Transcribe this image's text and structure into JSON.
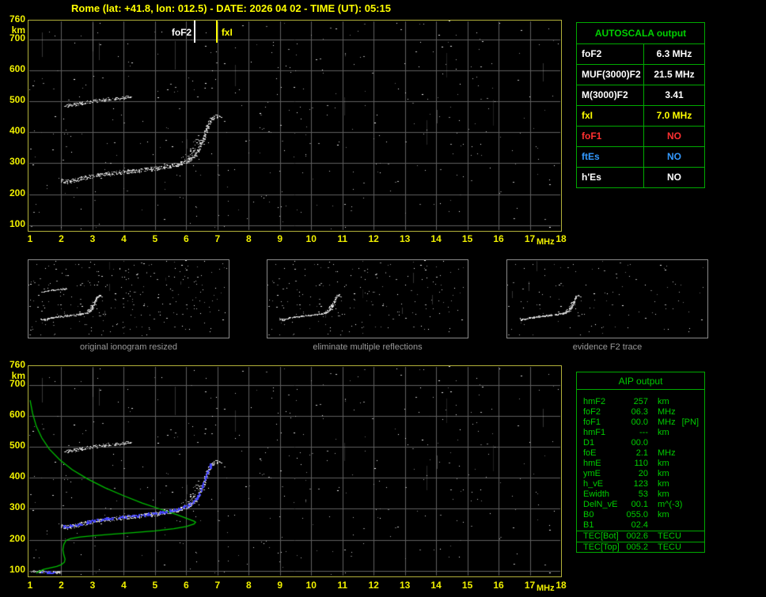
{
  "header": {
    "title": "Rome (lat: +41.8, lon: 012.5) - DATE: 2026 04 02 - TIME (UT): 05:15"
  },
  "colors": {
    "title": "#ffff00",
    "axis_label": "#f0f000",
    "plot_border": "#b2b03a",
    "grid": "#5f5f5f",
    "table_border": "#00aa00",
    "table_header_text": "#00d000",
    "aip_text": "#00cc00",
    "profile_green": "#00c000",
    "restored_blue": "#4646ff",
    "caption": "#9a9a9a"
  },
  "chart_data": {
    "type": "scatter",
    "description": "vertical-incidence ionogram: virtual height (km) vs sounding frequency (MHz); same ionogram in top and bottom panels, bottom panel adds restored F2 trace (blue) and electron density profile (green)",
    "x_unit": "MHz",
    "y_unit": "km",
    "xlim": [
      1,
      18
    ],
    "ylim_km": [
      82,
      760
    ],
    "x_ticks": [
      "1",
      "2",
      "3",
      "4",
      "5",
      "6",
      "7",
      "8",
      "9",
      "10",
      "11",
      "12",
      "13",
      "14",
      "15",
      "16",
      "17",
      "18"
    ],
    "y_axis_top_tick": "760",
    "y_ticks": [
      "700",
      "600",
      "500",
      "400",
      "300",
      "200",
      "100"
    ],
    "grid_km": [
      100,
      200,
      300,
      400,
      500,
      600,
      700
    ],
    "markers": [
      {
        "label": "foF2",
        "x": 6.3,
        "color": "#ffffff",
        "label_side": "left"
      },
      {
        "label": "fxI",
        "x": 7.0,
        "color": "#ffff00",
        "label_side": "right"
      }
    ],
    "traces": {
      "f2": {
        "name": "F-region echo trace",
        "density": 2.2,
        "jitter_x": 3,
        "jitter_y": 5,
        "points": [
          [
            1.95,
            250
          ],
          [
            2.05,
            243
          ],
          [
            2.2,
            241
          ],
          [
            2.5,
            248
          ],
          [
            2.9,
            258
          ],
          [
            3.4,
            266
          ],
          [
            3.9,
            272
          ],
          [
            4.4,
            277
          ],
          [
            4.9,
            283
          ],
          [
            5.3,
            289
          ],
          [
            5.7,
            297
          ],
          [
            6.0,
            307
          ],
          [
            6.2,
            320
          ],
          [
            6.35,
            338
          ],
          [
            6.45,
            358
          ],
          [
            6.55,
            382
          ],
          [
            6.62,
            405
          ],
          [
            6.7,
            428
          ],
          [
            6.8,
            445
          ],
          [
            6.95,
            452
          ],
          [
            7.08,
            455
          ]
        ]
      },
      "second_hop": {
        "name": "second-hop multiple reflection",
        "density": 1.6,
        "jitter_x": 3,
        "jitter_y": 4,
        "points": [
          [
            2.05,
            482
          ],
          [
            2.35,
            489
          ],
          [
            2.7,
            496
          ],
          [
            3.1,
            502
          ],
          [
            3.5,
            507
          ],
          [
            3.85,
            511
          ],
          [
            4.2,
            514
          ]
        ]
      },
      "spread": {
        "name": "spread echoes near F2 cusp",
        "density": 1.2,
        "jitter_x": 7,
        "jitter_y": 11,
        "points": [
          [
            5.85,
            302
          ],
          [
            6.05,
            318
          ],
          [
            6.2,
            340
          ],
          [
            6.3,
            362
          ],
          [
            6.38,
            385
          ]
        ]
      },
      "e_region": {
        "name": "E-region echo",
        "density": 2.0,
        "jitter_x": 2,
        "jitter_y": 3,
        "points": [
          [
            1.05,
            100
          ],
          [
            1.5,
            97
          ],
          [
            2.0,
            96
          ]
        ]
      }
    },
    "noise": {
      "seed": 9001,
      "plot_count": 400,
      "streak_count": 12
    },
    "profile": [
      [
        1.0,
        650
      ],
      [
        1.08,
        608
      ],
      [
        1.2,
        566
      ],
      [
        1.38,
        528
      ],
      [
        1.62,
        492
      ],
      [
        1.95,
        458
      ],
      [
        2.35,
        426
      ],
      [
        2.85,
        396
      ],
      [
        3.4,
        368
      ],
      [
        4.0,
        342
      ],
      [
        4.6,
        318
      ],
      [
        5.2,
        298
      ],
      [
        5.7,
        281
      ],
      [
        6.05,
        268
      ],
      [
        6.25,
        260
      ],
      [
        6.3,
        257
      ],
      [
        6.25,
        251
      ],
      [
        6.0,
        243
      ],
      [
        5.6,
        236
      ],
      [
        5.0,
        229
      ],
      [
        4.3,
        223
      ],
      [
        3.6,
        218
      ],
      [
        3.0,
        213
      ],
      [
        2.6,
        209
      ],
      [
        2.3,
        204
      ],
      [
        2.15,
        198
      ],
      [
        2.08,
        185
      ],
      [
        2.05,
        168
      ],
      [
        2.08,
        152
      ],
      [
        2.12,
        138
      ],
      [
        2.1,
        128
      ],
      [
        2.0,
        120
      ],
      [
        1.85,
        114
      ],
      [
        1.65,
        110
      ],
      [
        1.45,
        105
      ],
      [
        1.3,
        99
      ],
      [
        1.2,
        92
      ]
    ],
    "restored_blue": {
      "f_start": 2.15,
      "f_end": 6.72,
      "e_points": [
        [
          1.35,
          98
        ],
        [
          1.8,
          96
        ]
      ]
    }
  },
  "autoscala_table": {
    "title": "AUTOSCALA output",
    "rows": [
      {
        "label": "foF2",
        "value": "6.3 MHz",
        "color": "#ffffff"
      },
      {
        "label": "MUF(3000)F2",
        "value": "21.5 MHz",
        "color": "#ffffff"
      },
      {
        "label": "M(3000)F2",
        "value": "3.41",
        "color": "#ffffff"
      },
      {
        "label": "fxI",
        "value": "7.0 MHz",
        "color": "#ffff00"
      },
      {
        "label": "foF1",
        "value": "NO",
        "color": "#ff3030"
      },
      {
        "label": "ftEs",
        "value": "NO",
        "color": "#3399ff"
      },
      {
        "label": "h'Es",
        "value": "NO",
        "color": "#ffffff"
      }
    ]
  },
  "thumbnails": [
    {
      "caption": "original ionogram resized",
      "noise": 260,
      "streaks": 6,
      "traces": [
        "f2",
        "second_hop",
        "spread"
      ]
    },
    {
      "caption": "eliminate multiple reflections",
      "noise": 200,
      "streaks": 5,
      "traces": [
        "f2",
        "spread"
      ]
    },
    {
      "caption": "evidence F2 trace",
      "noise": 120,
      "streaks": 3,
      "traces": [
        "f2",
        "spread"
      ]
    }
  ],
  "aip_table": {
    "title": "AIP output",
    "rows": [
      {
        "name": "hmF2",
        "value": "257",
        "unit": "km",
        "note": ""
      },
      {
        "name": "foF2",
        "value": "06.3",
        "unit": "MHz",
        "note": ""
      },
      {
        "name": "foF1",
        "value": "00.0",
        "unit": "MHz",
        "note": "[PN]"
      },
      {
        "name": "hmF1",
        "value": "---",
        "unit": "km",
        "note": ""
      },
      {
        "name": "D1",
        "value": "00.0",
        "unit": "",
        "note": ""
      },
      {
        "name": "foE",
        "value": "2.1",
        "unit": "MHz",
        "note": ""
      },
      {
        "name": "hmE",
        "value": "110",
        "unit": "km",
        "note": ""
      },
      {
        "name": "ymE",
        "value": "20",
        "unit": "km",
        "note": ""
      },
      {
        "name": "h_vE",
        "value": "123",
        "unit": "km",
        "note": ""
      },
      {
        "name": "Ewidth",
        "value": "53",
        "unit": "km",
        "note": ""
      },
      {
        "name": "DelN_vE",
        "value": "00.1",
        "unit": "m^(-3)",
        "note": ""
      },
      {
        "name": "B0",
        "value": "055.0",
        "unit": "km",
        "note": ""
      },
      {
        "name": "B1",
        "value": "02.4",
        "unit": "",
        "note": ""
      }
    ],
    "tec_rows": [
      {
        "name": "TEC[Bot]",
        "value": "002.6",
        "unit": "TECU"
      },
      {
        "name": "TEC[Top]",
        "value": "005.2",
        "unit": "TECU"
      }
    ]
  }
}
